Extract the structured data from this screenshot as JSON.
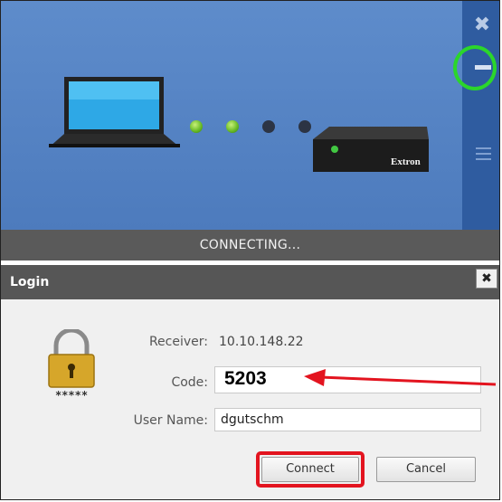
{
  "window": {
    "close_icon": "✖",
    "hamburger_icon": "menu-icon"
  },
  "status": {
    "text": "CONNECTING..."
  },
  "login": {
    "title": "Login",
    "close_label": "✖",
    "receiver_label": "Receiver:",
    "receiver_value": "10.10.148.22",
    "code_label": "Code:",
    "code_value": "5203",
    "username_label": "User Name:",
    "username_value": "dgutschm",
    "lock_mask": "*****",
    "connect_label": "Connect",
    "cancel_label": "Cancel"
  },
  "device": {
    "brand": "Extron"
  },
  "colors": {
    "header_blue": "#4d7bbd",
    "sidebar_blue": "#2f5ca0",
    "highlight_green": "#2bd62b",
    "highlight_red": "#e3141f"
  }
}
